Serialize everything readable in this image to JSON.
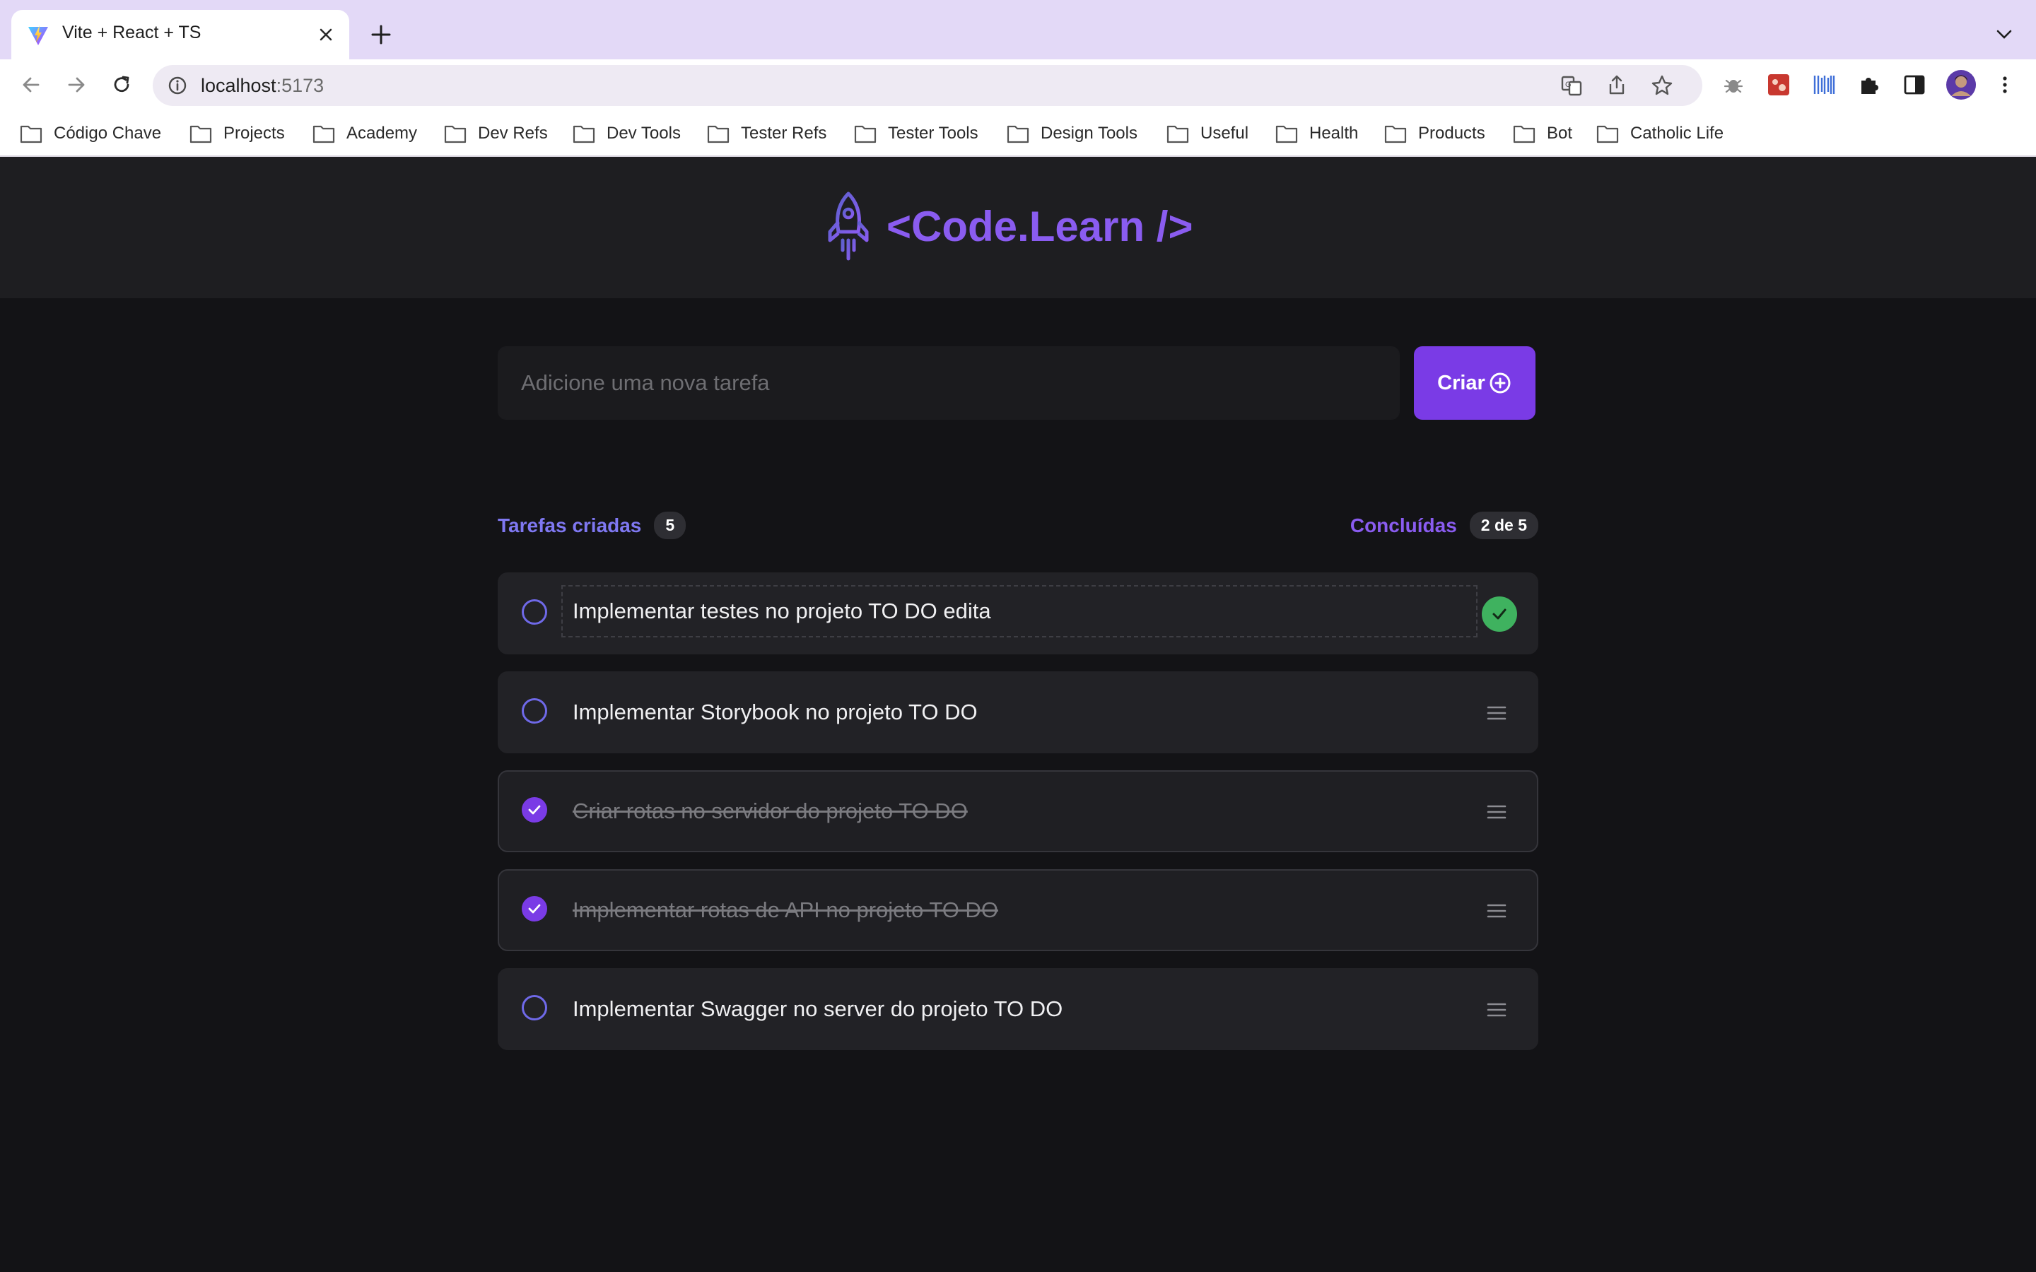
{
  "browser": {
    "tab_title": "Vite + React + TS",
    "url_host": "localhost",
    "url_port": ":5173",
    "bookmarks": [
      "Código Chave",
      "Projects",
      "Academy",
      "Dev Refs",
      "Dev Tools",
      "Tester Refs",
      "Tester Tools",
      "Design Tools",
      "Useful",
      "Health",
      "Products",
      "Bot",
      "Catholic Life"
    ]
  },
  "app": {
    "logo_text": "<Code.Learn />",
    "new_task_placeholder": "Adicione uma nova tarefa",
    "create_label": "Criar",
    "counters": {
      "created_label": "Tarefas criadas",
      "created_count": "5",
      "done_label": "Concluídas",
      "done_count": "2 de 5"
    },
    "tasks": [
      {
        "text": "Implementar testes no projeto TO DO edita",
        "done": false,
        "editing": true
      },
      {
        "text": "Implementar Storybook no projeto TO DO",
        "done": false
      },
      {
        "text": "Criar rotas no servidor do projeto TO DO",
        "done": true
      },
      {
        "text": "Implementar rotas de API no projeto TO DO",
        "done": true
      },
      {
        "text": "Implementar Swagger no server do projeto TO DO",
        "done": false
      }
    ]
  },
  "colors": {
    "accent": "#7a3be6",
    "accent_text": "#8a5cf0",
    "created_text": "#7f78f2",
    "success": "#3fb25f",
    "background": "#131316",
    "header": "#1e1e21"
  },
  "icons": {
    "favicon": "vite-logo-icon",
    "create": "plus-circle-icon",
    "task_menu": "hamburger-menu-icon",
    "save": "check-icon",
    "logo": "rocket-icon"
  }
}
